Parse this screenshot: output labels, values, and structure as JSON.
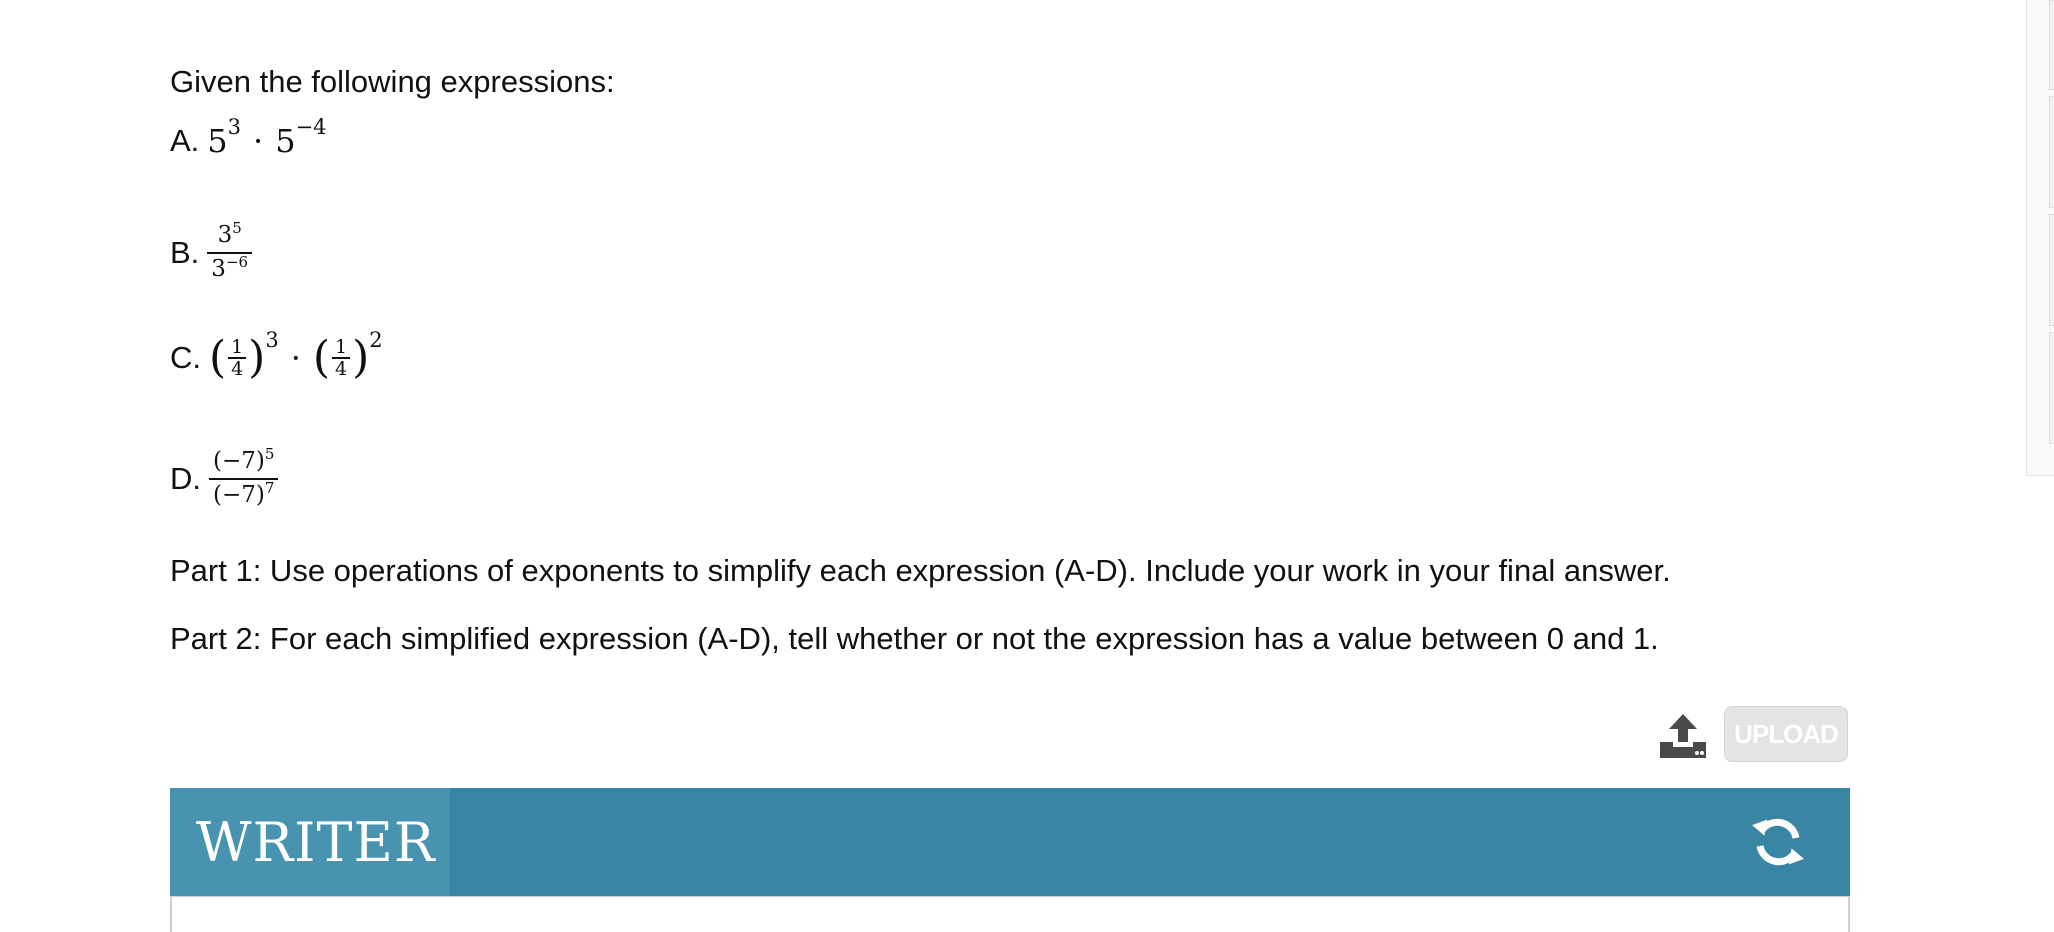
{
  "intro": "Given the following expressions:",
  "expressions": {
    "a": {
      "letter": "A.",
      "base1": "5",
      "exp1": "3",
      "dot": "·",
      "base2": "5",
      "exp2": "−4"
    },
    "b": {
      "letter": "B.",
      "num_base": "3",
      "num_exp": "5",
      "den_base": "3",
      "den_exp": "−6"
    },
    "c": {
      "letter": "C.",
      "frac_num": "1",
      "frac_den": "4",
      "exp1": "3",
      "dot": "·",
      "exp2": "2",
      "lparen": "(",
      "rparen": ")"
    },
    "d": {
      "letter": "D.",
      "num": "(−7)",
      "num_exp": "5",
      "den": "(−7)",
      "den_exp": "7"
    }
  },
  "part1": "Part 1: Use operations of exponents to simplify each expression (A-D). Include your work in your final answer.",
  "part2": "Part 2: For each simplified expression (A-D), tell whether or not the expression has a value between 0 and 1.",
  "upload": {
    "label": "UPLOAD",
    "icon": "upload-icon"
  },
  "writer": {
    "title": "WRITER",
    "refresh_icon": "refresh-icon",
    "bar_color": "#3886a4",
    "title_bg": "#4894b0"
  }
}
